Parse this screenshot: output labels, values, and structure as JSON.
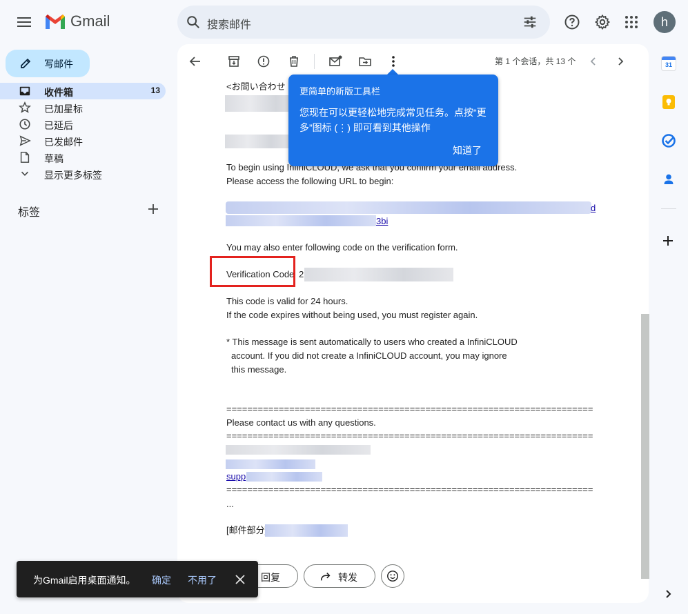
{
  "header": {
    "app_name": "Gmail",
    "search_placeholder": "搜索邮件",
    "avatar_letter": "h"
  },
  "sidebar": {
    "compose_label": "写邮件",
    "items": [
      {
        "label": "收件箱",
        "count": "13",
        "icon": "inbox-icon",
        "active": true
      },
      {
        "label": "已加星标",
        "icon": "star-icon"
      },
      {
        "label": "已延后",
        "icon": "clock-icon"
      },
      {
        "label": "已发邮件",
        "icon": "send-icon"
      },
      {
        "label": "草稿",
        "icon": "draft-icon"
      },
      {
        "label": "显示更多标签",
        "icon": "chevron-down-icon"
      }
    ],
    "labels_heading": "标签"
  },
  "toolbar": {
    "pager_text": "第 1 个会话，共 13 个"
  },
  "tooltip": {
    "title": "更简单的新版工具栏",
    "body": "您现在可以更轻松地完成常见任务。点按“更多”图标 (⋮) 即可看到其他操作",
    "ok_label": "知道了"
  },
  "email": {
    "inquiry_line": "<お問い合わせ",
    "begin_line1": "To begin using InfiniCLOUD, we ask that you confirm your email address.",
    "begin_line2": "Please access the following URL to begin:",
    "url_tail": "d",
    "url_tail2": "3bi",
    "code_intro": "You may also enter following code on the verification form.",
    "code_label": "Verification Code",
    "code_first_char": "2",
    "valid_line1": "This code is valid for 24 hours.",
    "valid_line2": "If the code expires without being used, you must register again.",
    "note_line1": "* This message is sent automatically to users who created a InfiniCLOUD",
    "note_line2": "account. If you did not create a InfiniCLOUD account, you may ignore",
    "note_line3": "this message.",
    "separator": "========================================================================================",
    "contact_line": "Please contact us with any questions.",
    "support_prefix": "supp",
    "ellipsis": "...",
    "dept_prefix": "[邮件部分]"
  },
  "reply": {
    "reply_label": "回复",
    "forward_label": "转发"
  },
  "snackbar": {
    "message": "为Gmail启用桌面通知。",
    "confirm_label": "确定",
    "dismiss_label": "不用了"
  },
  "right_panel": {
    "calendar_day": "31"
  },
  "colors": {
    "accent_blue": "#1b73e8",
    "compose_bg": "#c2e7ff",
    "highlight_red": "#e3221e"
  }
}
